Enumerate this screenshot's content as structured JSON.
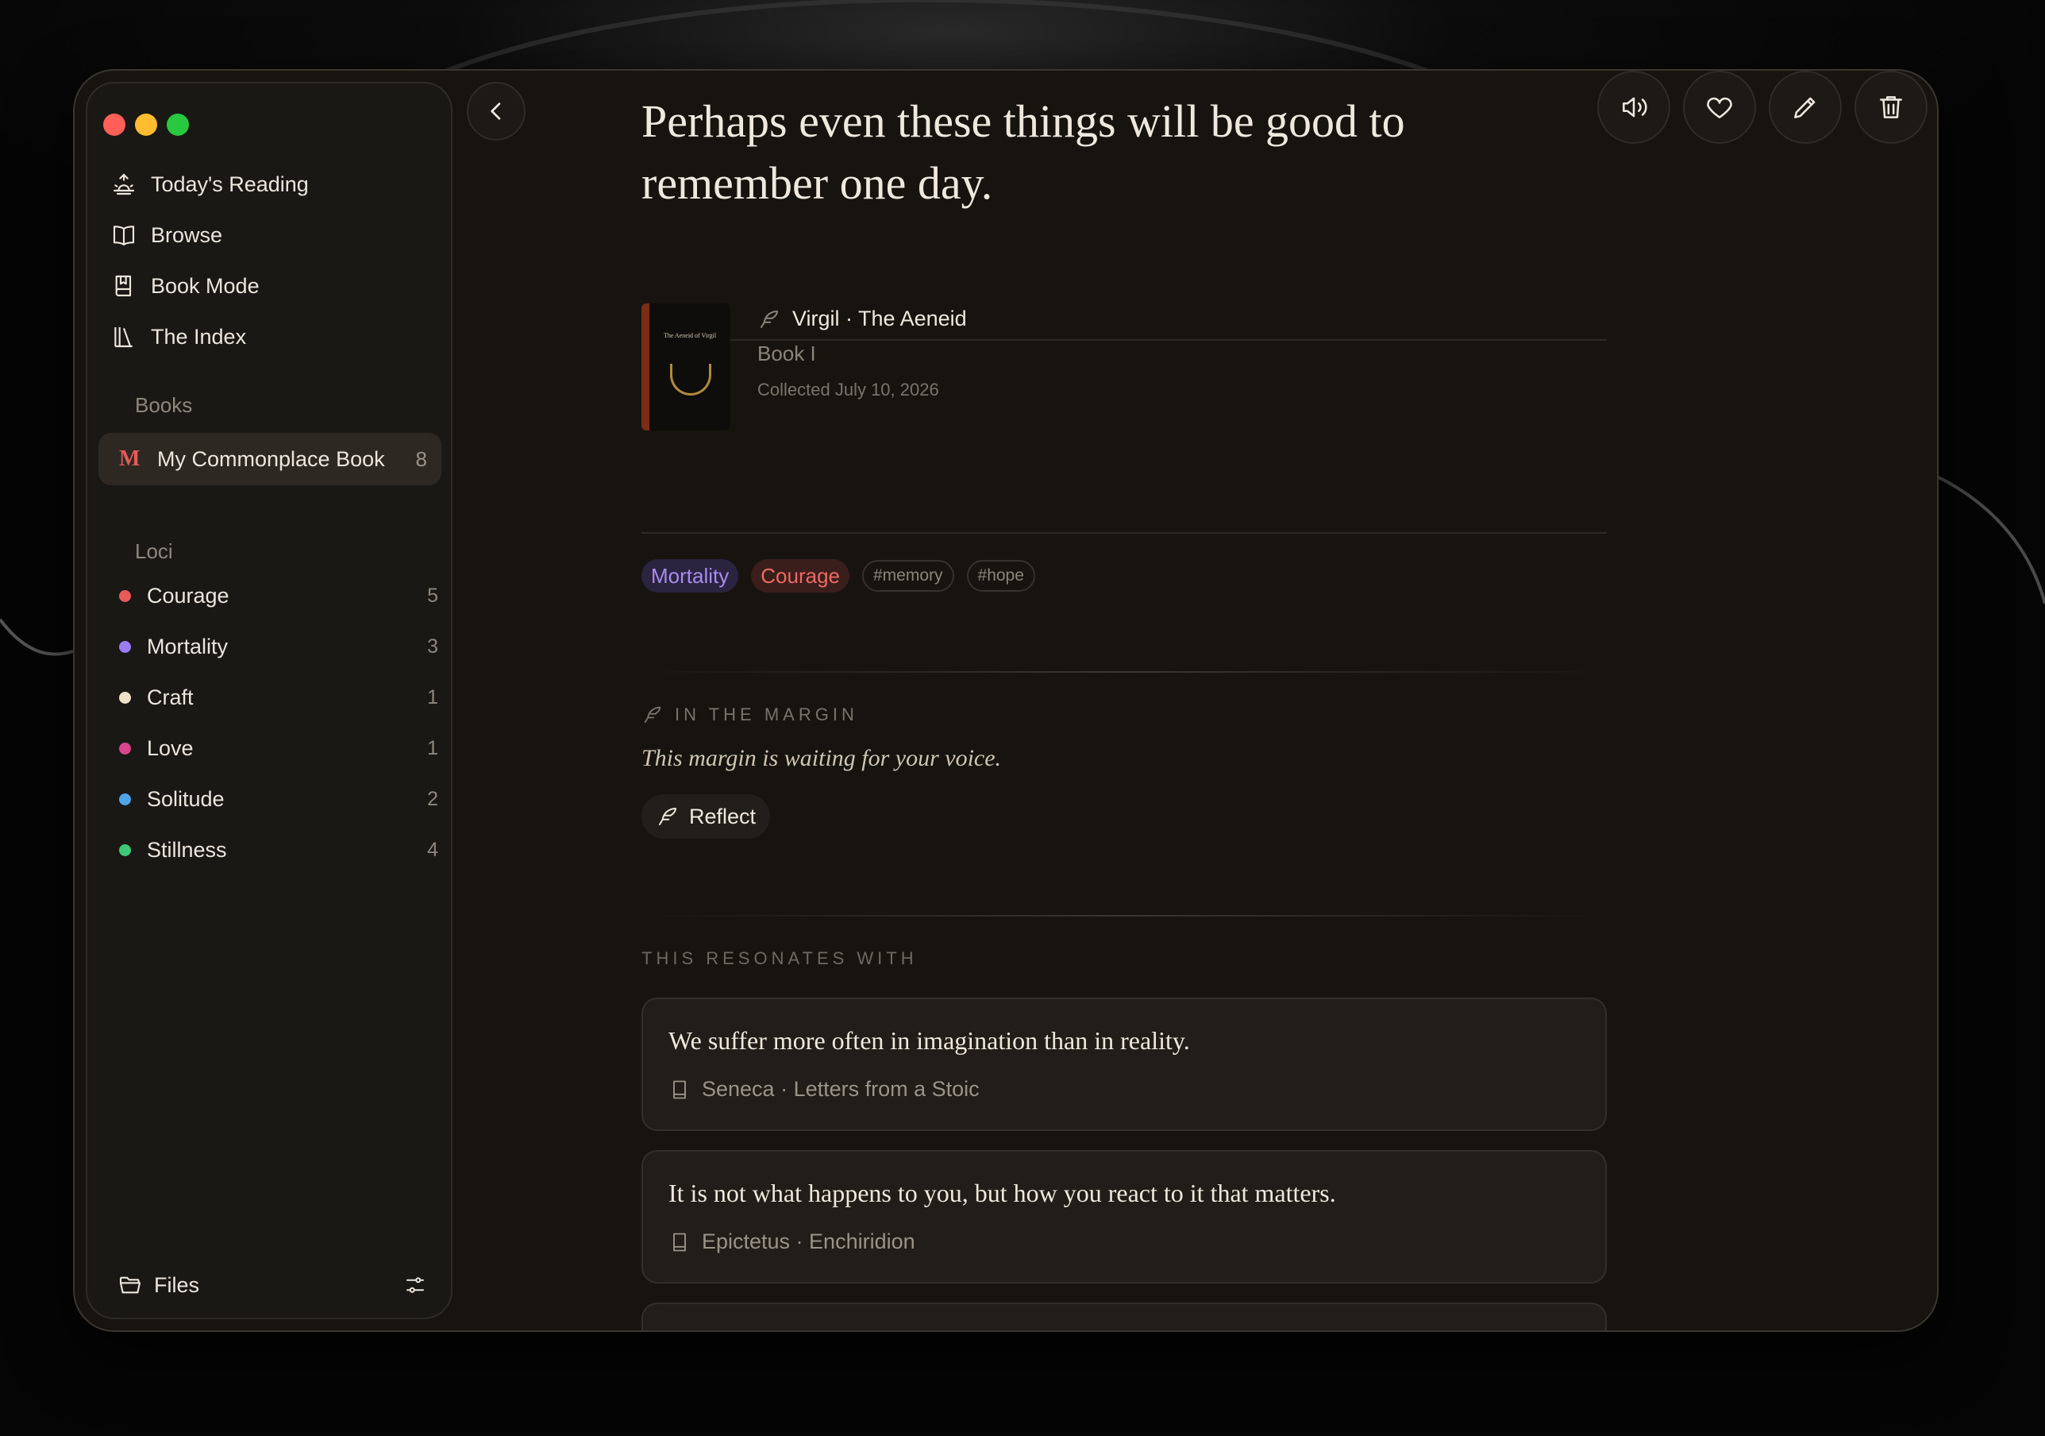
{
  "sidebar": {
    "nav": [
      {
        "label": "Today's Reading",
        "icon": "sunrise-icon"
      },
      {
        "label": "Browse",
        "icon": "open-book-icon"
      },
      {
        "label": "Book Mode",
        "icon": "bookmark-book-icon"
      },
      {
        "label": "The Index",
        "icon": "library-icon"
      }
    ],
    "books_heading": "Books",
    "book": {
      "initial": "M",
      "name": "My Commonplace Book",
      "count": "8"
    },
    "loci_heading": "Loci",
    "loci": [
      {
        "name": "Courage",
        "count": "5",
        "color": "#e85a57"
      },
      {
        "name": "Mortality",
        "count": "3",
        "color": "#9b7cf2"
      },
      {
        "name": "Craft",
        "count": "1",
        "color": "#efe2c8"
      },
      {
        "name": "Love",
        "count": "1",
        "color": "#d9468f"
      },
      {
        "name": "Solitude",
        "count": "2",
        "color": "#4fa3e8"
      },
      {
        "name": "Stillness",
        "count": "4",
        "color": "#3ec97a"
      }
    ],
    "files_label": "Files"
  },
  "quote": {
    "text": "Perhaps even these things will be good to remember one day.",
    "author_work": "Virgil · The Aeneid",
    "section": "Book I",
    "collected": "Collected July 10, 2026",
    "cover_title": "The Aeneid of Virgil"
  },
  "tags": [
    {
      "label": "Mortality",
      "kind": "locus",
      "color": "#a98bf0"
    },
    {
      "label": "Courage",
      "kind": "locus",
      "color": "#ec6b62"
    },
    {
      "label": "#memory",
      "kind": "hashtag"
    },
    {
      "label": "#hope",
      "kind": "hashtag"
    }
  ],
  "margin": {
    "heading": "IN THE MARGIN",
    "placeholder": "This margin is waiting for your voice.",
    "reflect_label": "Reflect"
  },
  "resonates": {
    "heading": "THIS RESONATES WITH",
    "items": [
      {
        "quote": "We suffer more often in imagination than in reality.",
        "source": "Seneca · Letters from a Stoic"
      },
      {
        "quote": "It is not what happens to you, but how you react to it that matters.",
        "source": "Epictetus · Enchiridion"
      }
    ]
  }
}
